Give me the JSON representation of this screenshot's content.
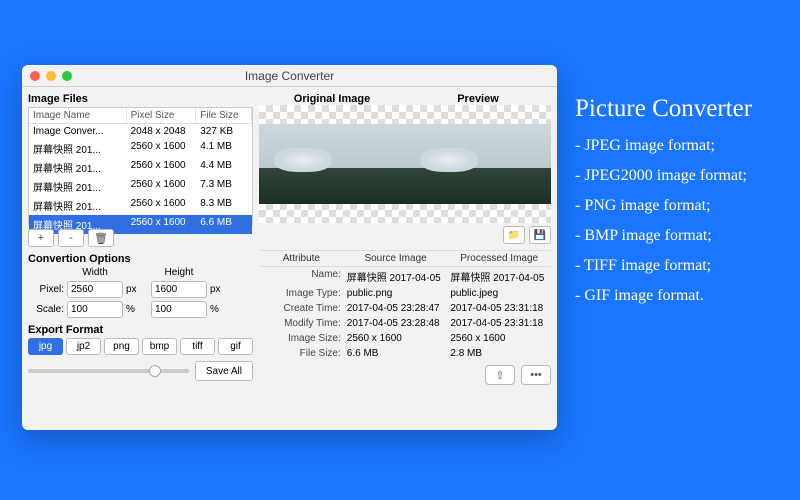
{
  "window": {
    "title": "Image Converter"
  },
  "left": {
    "files_label": "Image Files",
    "columns": [
      "Image Name",
      "Pixel Size",
      "File Size"
    ],
    "rows": [
      {
        "name": "Image Conver...",
        "size": "2048 x 2048",
        "fsize": "327 KB"
      },
      {
        "name": "屏幕快照 201...",
        "size": "2560 x 1600",
        "fsize": "4.1 MB"
      },
      {
        "name": "屏幕快照 201...",
        "size": "2560 x 1600",
        "fsize": "4.4 MB"
      },
      {
        "name": "屏幕快照 201...",
        "size": "2560 x 1600",
        "fsize": "7.3 MB"
      },
      {
        "name": "屏幕快照 201...",
        "size": "2560 x 1600",
        "fsize": "8.3 MB"
      },
      {
        "name": "屏幕快照 201...",
        "size": "2560 x 1600",
        "fsize": "6.6 MB",
        "selected": true
      }
    ],
    "add": "+",
    "remove": "-",
    "conv_label": "Convertion Options",
    "width_label": "Width",
    "height_label": "Height",
    "pixel_label": "Pixel:",
    "scale_label": "Scale:",
    "px_unit": "px",
    "pct_unit": "%",
    "width_val": "2560",
    "height_val": "1600",
    "scale_w": "100",
    "scale_h": "100",
    "export_label": "Export Format",
    "formats": [
      "jpg",
      "jp2",
      "png",
      "bmp",
      "tiff",
      "gif"
    ],
    "selected_format": "jpg",
    "save_all": "Save All"
  },
  "right": {
    "orig_label": "Original Image",
    "prev_label": "Preview",
    "attr_cols": [
      "Attribute",
      "Source Image",
      "Processed Image"
    ],
    "rows": [
      {
        "k": "Name:",
        "s": "屏幕快照 2017-04-05 ",
        "p": "屏幕快照 2017-04-05 "
      },
      {
        "k": "Image Type:",
        "s": "public.png",
        "p": "public.jpeg"
      },
      {
        "k": "Create Time:",
        "s": "2017-04-05 23:28:47",
        "p": "2017-04-05 23:31:18"
      },
      {
        "k": "Modify Time:",
        "s": "2017-04-05 23:28:48",
        "p": "2017-04-05 23:31:18"
      },
      {
        "k": "Image Size:",
        "s": "2560 x 1600",
        "p": "2560 x 1600"
      },
      {
        "k": "File Size:",
        "s": "6.6 MB",
        "p": "2.8 MB"
      }
    ],
    "share": "⇧",
    "more": "•••"
  },
  "marketing": {
    "title": "Picture Converter",
    "items": [
      "- JPEG image format;",
      "- JPEG2000 image format;",
      "- PNG image format;",
      "- BMP image format;",
      "- TIFF image format;",
      "- GIF image format."
    ]
  }
}
